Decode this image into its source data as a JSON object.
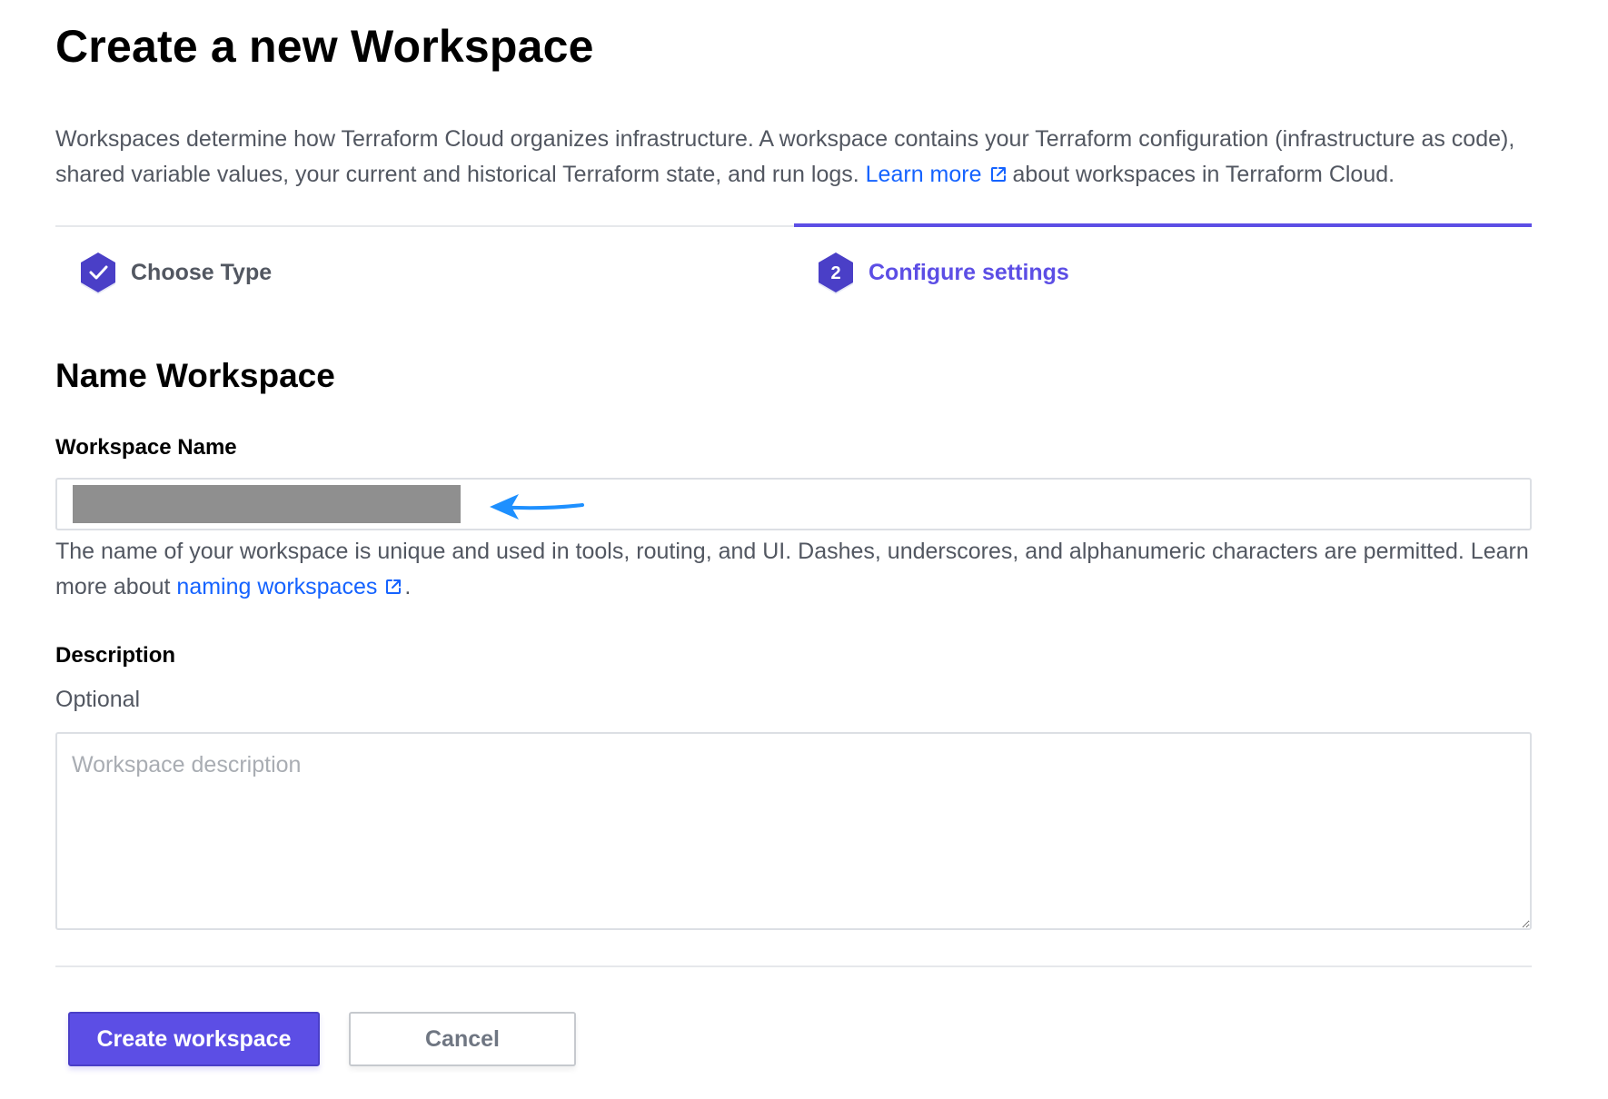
{
  "page": {
    "title": "Create a new Workspace",
    "intro_text_1": "Workspaces determine how Terraform Cloud organizes infrastructure. A workspace contains your Terraform configuration (infrastructure as code), shared variable values, your current and historical Terraform state, and run logs. ",
    "intro_link": "Learn more",
    "intro_text_2": "about workspaces in Terraform Cloud."
  },
  "stepper": {
    "steps": [
      {
        "label": "Choose Type",
        "state": "completed",
        "icon": "check-icon"
      },
      {
        "label": "Configure settings",
        "state": "active",
        "number": "2"
      }
    ],
    "active_color": "#5c4ee5"
  },
  "form": {
    "section_title": "Name Workspace",
    "name_label": "Workspace Name",
    "name_value": "",
    "name_help_1": "The name of your workspace is unique and used in tools, routing, and UI. Dashes, underscores, and alphanumeric characters are permitted. Learn more about ",
    "name_help_link": "naming workspaces",
    "name_help_2": ".",
    "description_label": "Description",
    "description_optional": "Optional",
    "description_placeholder": "Workspace description"
  },
  "actions": {
    "create_label": "Create workspace",
    "cancel_label": "Cancel"
  },
  "colors": {
    "primary": "#5c4ee5",
    "link": "#1563ff",
    "annotation_arrow": "#1e90ff"
  }
}
